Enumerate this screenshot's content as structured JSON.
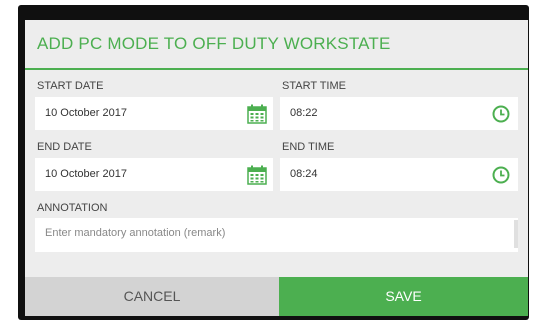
{
  "dialog": {
    "title": "ADD PC MODE TO OFF DUTY WORKSTATE",
    "accent_color": "#4caf50"
  },
  "start_date": {
    "label": "START DATE",
    "value": "10 October 2017",
    "icon": "calendar-icon"
  },
  "start_time": {
    "label": "START TIME",
    "value": "08:22",
    "icon": "clock-icon"
  },
  "end_date": {
    "label": "END DATE",
    "value": "10 October 2017",
    "icon": "calendar-icon"
  },
  "end_time": {
    "label": "END TIME",
    "value": "08:24",
    "icon": "clock-icon"
  },
  "annotation": {
    "label": "ANNOTATION",
    "placeholder": "Enter mandatory annotation (remark)"
  },
  "buttons": {
    "cancel_label": "CANCEL",
    "save_label": "SAVE"
  }
}
